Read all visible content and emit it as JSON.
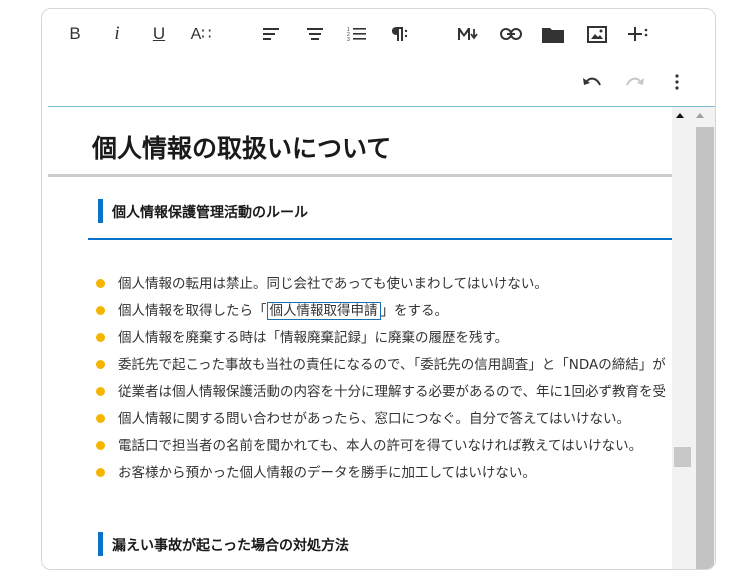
{
  "toolbar": {
    "bold": "B",
    "italic": "i",
    "underline": "U",
    "font_size": "A∷",
    "icons": [
      "align-left-icon",
      "align-center-icon",
      "ordered-list-icon",
      "paragraph-icon",
      "markdown-icon",
      "link-icon",
      "folder-icon",
      "image-icon",
      "insert-more-icon",
      "undo-icon",
      "redo-icon",
      "more-vert-icon"
    ]
  },
  "document": {
    "title": "個人情報の取扱いについて",
    "section1": {
      "heading": "個人情報保護管理活動のルール",
      "items": [
        {
          "text": "個人情報の転用は禁止。同じ会社であっても使いまわしてはいけない。"
        },
        {
          "pre": "個人情報を取得したら「",
          "boxed": "個人情報取得申請",
          "post": "」をする。"
        },
        {
          "text": "個人情報を廃棄する時は「情報廃棄記録」に廃棄の履歴を残す。"
        },
        {
          "text": "委託先で起こった事故も当社の責任になるので、「委託先の信用調査」と「NDAの締結」が"
        },
        {
          "text": "従業者は個人情報保護活動の内容を十分に理解する必要があるので、年に1回必ず教育を受"
        },
        {
          "text": "個人情報に関する問い合わせがあったら、窓口につなぐ。自分で答えてはいけない。"
        },
        {
          "text": "電話口で担当者の名前を聞かれても、本人の許可を得ていなければ教えてはいけない。"
        },
        {
          "text": "お客様から預かった個人情報のデータを勝手に加工してはいけない。"
        }
      ]
    },
    "section2": {
      "heading": "漏えい事故が起こった場合の対処方法"
    }
  },
  "colors": {
    "accent_blue": "#0a73c9",
    "bullet": "#f5b400"
  }
}
